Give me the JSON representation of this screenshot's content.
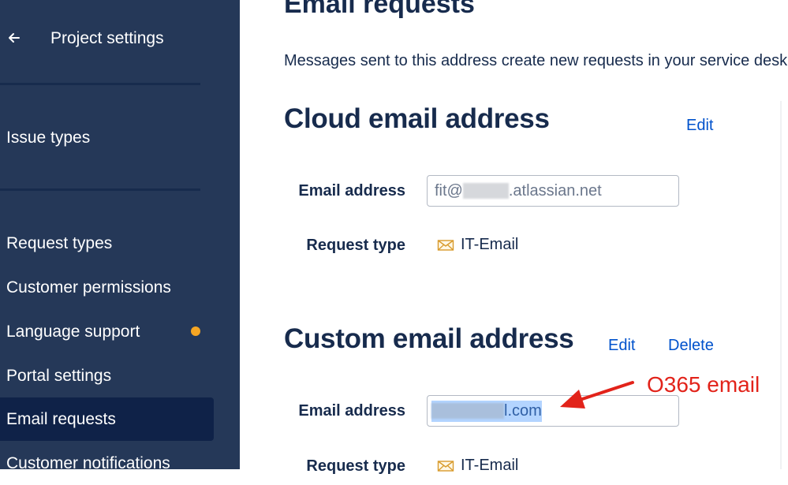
{
  "sidebar": {
    "back_icon": "arrow-left-icon",
    "title": "Project settings",
    "items": [
      {
        "label": "Issue types"
      },
      {
        "label": "Request types"
      },
      {
        "label": "Customer permissions"
      },
      {
        "label": "Language support"
      },
      {
        "label": "Portal settings"
      },
      {
        "label": "Email requests",
        "active": true
      },
      {
        "label": "Customer notifications"
      }
    ],
    "status_dot_color": "#f6a623"
  },
  "main": {
    "page_title": "Email requests",
    "description": "Messages sent to this address create new requests in your service desk.",
    "cloud": {
      "title": "Cloud email address",
      "edit_label": "Edit",
      "email_label": "Email address",
      "email_prefix": "fit@",
      "email_suffix": ".atlassian.net",
      "request_type_label": "Request type",
      "request_type_icon": "envelope-icon",
      "request_type_value": "IT-Email"
    },
    "custom": {
      "title": "Custom email address",
      "edit_label": "Edit",
      "delete_label": "Delete",
      "email_label": "Email address",
      "email_suffix": "l.com",
      "request_type_label": "Request type",
      "request_type_icon": "envelope-icon",
      "request_type_value": "IT-Email"
    },
    "annotation": "O365 email"
  },
  "colors": {
    "sidebar_bg": "#253858",
    "sidebar_active": "#0f2248",
    "link": "#0052cc",
    "annotation": "#e2231a"
  }
}
